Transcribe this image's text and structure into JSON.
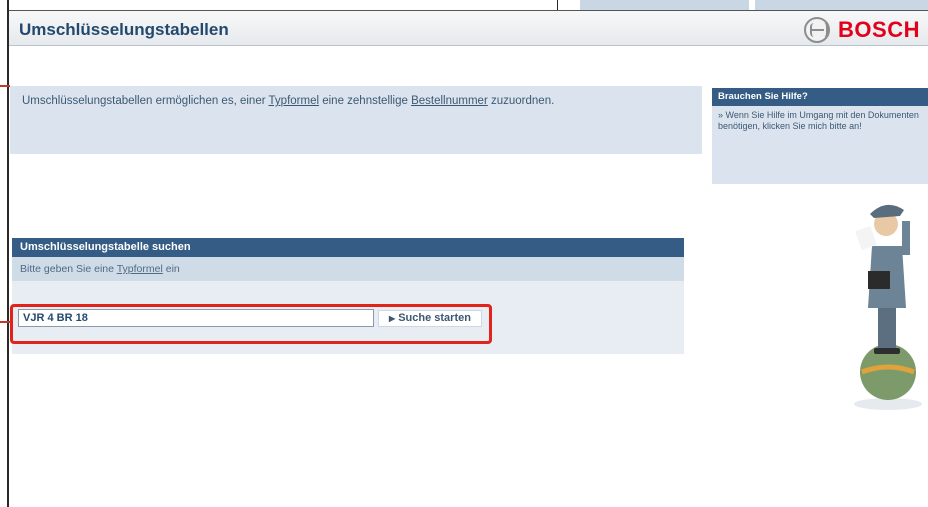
{
  "header": {
    "title": "Umschlüsselungstabellen",
    "brand": "BOSCH"
  },
  "intro": {
    "text_before": "Umschlüsselungstabellen ermöglichen es, einer ",
    "link1": "Typformel",
    "text_middle": " eine zehnstellige ",
    "link2": "Bestellnummer",
    "text_after": " zuzuordnen."
  },
  "help": {
    "title": "Brauchen Sie Hilfe?",
    "text": "» Wenn Sie Hilfe im Umgang mit den Dokumenten benötigen, klicken Sie mich bitte an!"
  },
  "search": {
    "title": "Umschlüsselungstabelle suchen",
    "hint_before": "Bitte geben Sie eine ",
    "hint_link": "Typformel",
    "hint_after": " ein",
    "input_value": "VJR 4 BR 18",
    "button_label": "Suche starten"
  },
  "colors": {
    "accent": "#345c84",
    "brand": "#e2001a",
    "annotation": "#e2231a"
  }
}
